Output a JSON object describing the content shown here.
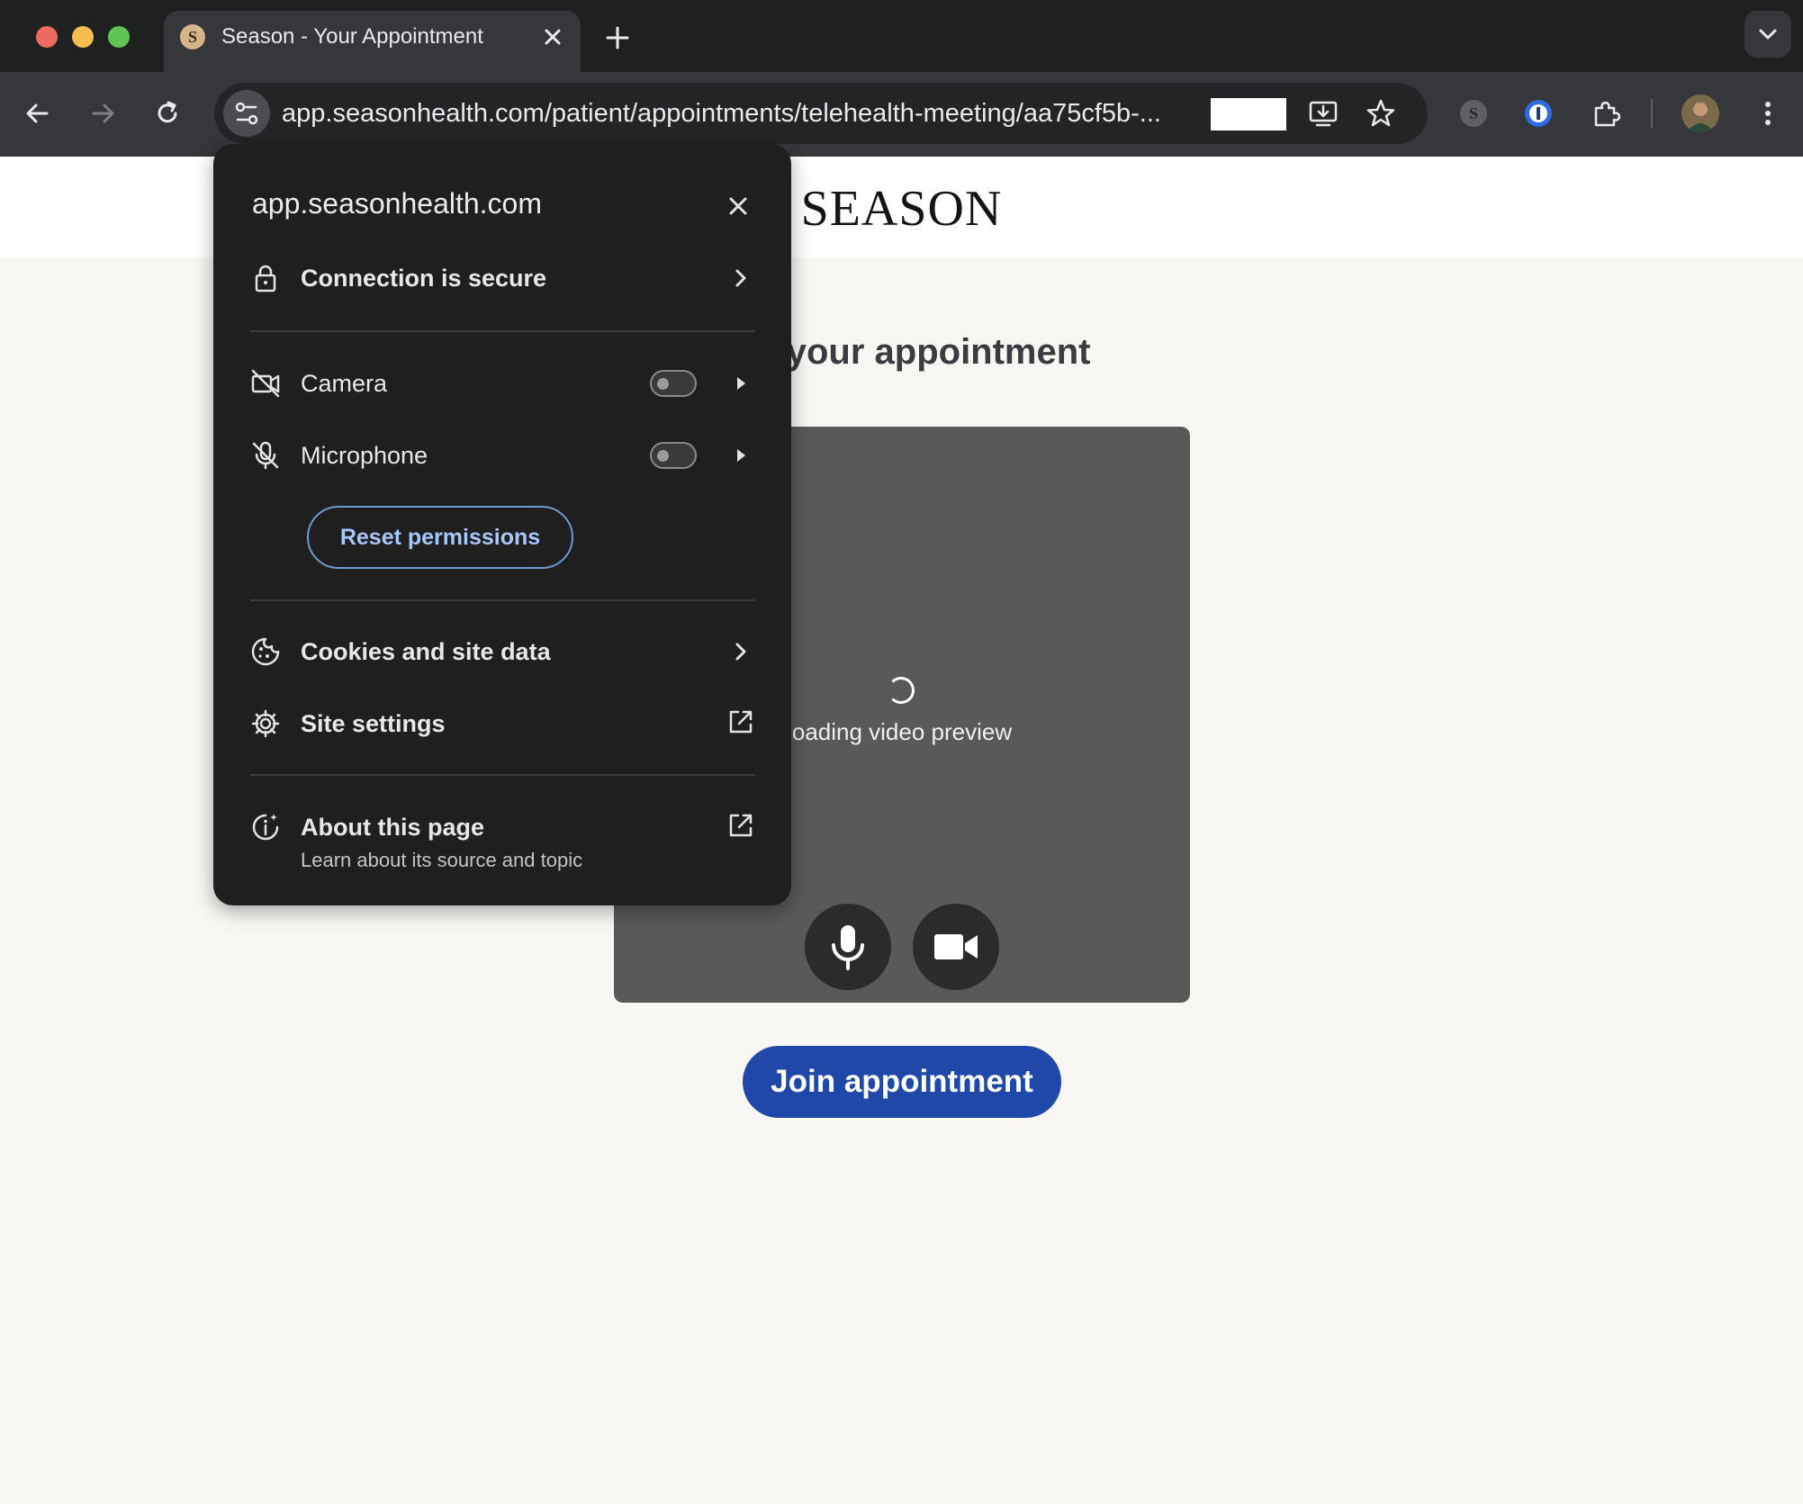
{
  "browser": {
    "tab": {
      "title": "Season - Your Appointment",
      "favicon_letter": "S"
    },
    "address_bar": {
      "url": "app.seasonhealth.com/patient/appointments/telehealth-meeting/aa75cf5b-..."
    },
    "extension_letter": "S"
  },
  "site_info_popup": {
    "domain": "app.seasonhealth.com",
    "connection": "Connection is secure",
    "camera": {
      "label": "Camera",
      "enabled": false
    },
    "microphone": {
      "label": "Microphone",
      "enabled": false
    },
    "reset_button": "Reset permissions",
    "cookies": "Cookies and site data",
    "site_settings": "Site settings",
    "about": {
      "title": "About this page",
      "subtitle": "Learn about its source and topic"
    }
  },
  "page": {
    "logo": "SEASON",
    "welcome_visible": "e to your appointment",
    "video_preview": {
      "loading_visible": "oading video preview"
    },
    "join_button": "Join appointment"
  },
  "colors": {
    "join_button": "#1f48a8",
    "popup_bg": "#1f1f1f",
    "page_bg": "#f8f7f4",
    "link_blue": "#a8c7fa"
  }
}
